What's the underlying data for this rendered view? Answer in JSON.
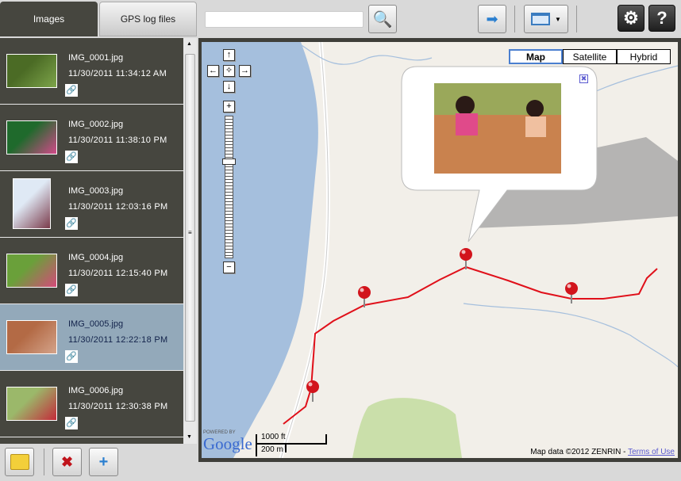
{
  "tabs": [
    {
      "label": "Images"
    },
    {
      "label": "GPS log files"
    }
  ],
  "search": {
    "value": "",
    "placeholder": ""
  },
  "images": [
    {
      "name": "IMG_0001.jpg",
      "date": "11/30/2011 11:34:12 AM",
      "colors": [
        "#4b6b25",
        "#7da44a"
      ]
    },
    {
      "name": "IMG_0002.jpg",
      "date": "11/30/2011 11:38:10 PM",
      "colors": [
        "#1f6a2c",
        "#d24a8a"
      ]
    },
    {
      "name": "IMG_0003.jpg",
      "date": "11/30/2011 12:03:16 PM",
      "colors": [
        "#dfe9f5",
        "#7a3a4a"
      ]
    },
    {
      "name": "IMG_0004.jpg",
      "date": "11/30/2011 12:15:40 PM",
      "colors": [
        "#6aa03a",
        "#d54a7a"
      ]
    },
    {
      "name": "IMG_0005.jpg",
      "date": "11/30/2011 12:22:18 PM",
      "colors": [
        "#b36a45",
        "#d4a38a"
      ]
    },
    {
      "name": "IMG_0006.jpg",
      "date": "11/30/2011 12:30:38 PM",
      "colors": [
        "#9bb86a",
        "#c42a3a"
      ]
    }
  ],
  "selected_index": 4,
  "map": {
    "types": [
      "Map",
      "Satellite",
      "Hybrid"
    ],
    "active_type": "Map",
    "scale_ft": "1000 ft",
    "scale_m": "200 m",
    "powered_by": "POWERED BY",
    "logo": "Google",
    "attribution": "Map data ©2012 ZENRIN -",
    "terms": "Terms of Use",
    "zoom_level_fraction": 0.3
  },
  "colors": {
    "route": "#e0101a",
    "water": "#a5bfdd",
    "park": "#cadfaa",
    "panel": "#46463f",
    "selected": "#93a9ba"
  }
}
